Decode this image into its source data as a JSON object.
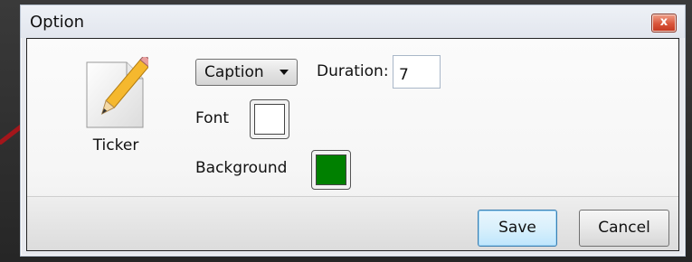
{
  "window": {
    "title": "Option",
    "close_glyph": "x"
  },
  "ticker": {
    "label": "Ticker",
    "icon": "pencil-document-icon"
  },
  "caption_select": {
    "value": "Caption"
  },
  "duration": {
    "label": "Duration:",
    "value": "7"
  },
  "font": {
    "label": "Font",
    "color": "#ffffff"
  },
  "background": {
    "label": "Background",
    "color": "#008000"
  },
  "buttons": {
    "save": "Save",
    "cancel": "Cancel"
  },
  "annotation": {
    "arrow_color": "#a3161b"
  }
}
